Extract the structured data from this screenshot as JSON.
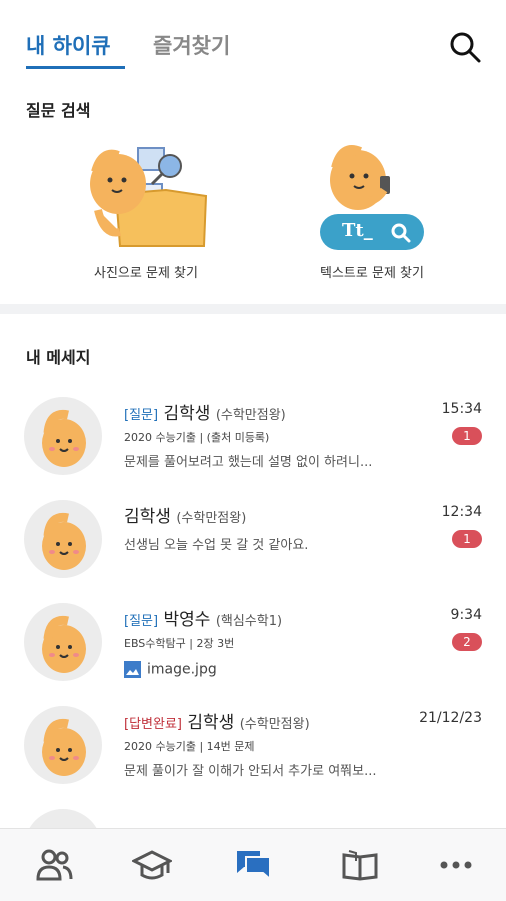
{
  "header": {
    "tab_active": "내 하이큐",
    "tab_inactive": "즐겨찾기",
    "search_icon": "search-icon"
  },
  "question_search": {
    "title": "질문 검색",
    "photo_label": "사진으로 문제 찾기",
    "text_label": "텍스트로 문제 찾기",
    "text_search_box": "Tt_"
  },
  "messages_section": {
    "title": "내 메세지",
    "items": [
      {
        "tag": "[질문]",
        "tag_type": "question",
        "name": "김학생",
        "sub": "(수학만점왕)",
        "source": "2020 수능기출 | (출처 미등록)",
        "preview": "문제를 풀어보려고 했는데 설명 없이 하려니...",
        "time": "15:34",
        "badge": "1"
      },
      {
        "tag": "",
        "tag_type": "",
        "name": "김학생",
        "sub": "(수학만점왕)",
        "source": "",
        "preview": "선생님 오늘 수업 못 갈 것 같아요.",
        "time": "12:34",
        "badge": "1"
      },
      {
        "tag": "[질문]",
        "tag_type": "question",
        "name": "박영수",
        "sub": "(핵심수학1)",
        "source": "EBS수학탐구 | 2장 3번",
        "attachment": "image.jpg",
        "time": "9:34",
        "badge": "2"
      },
      {
        "tag": "[답변완료]",
        "tag_type": "answered",
        "name": "김학생",
        "sub": "(수학만점왕)",
        "source": "2020 수능기출 | 14번 문제",
        "preview": "문제 풀이가 잘 이해가 안되서 추가로 여쭤보...",
        "time": "21/12/23",
        "badge": ""
      }
    ]
  },
  "bottom_nav": [
    "people-icon",
    "graduation-cap-icon",
    "chat-icon",
    "book-icon",
    "more-icon"
  ],
  "colors": {
    "accent": "#1f6fb8",
    "badge": "#d9505a",
    "answered": "#c0303a",
    "mascot": "#f5b35d"
  }
}
